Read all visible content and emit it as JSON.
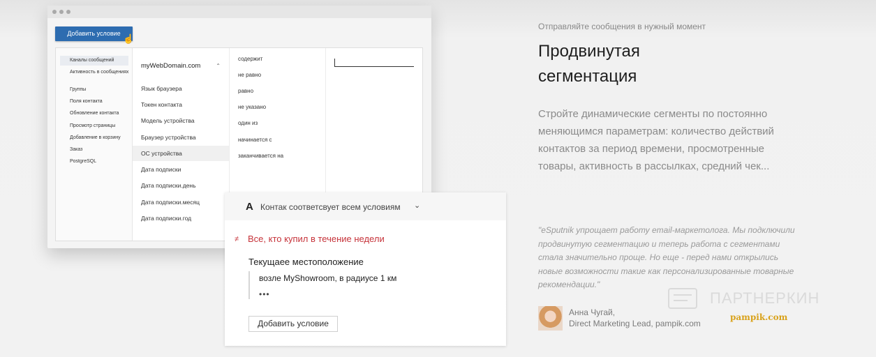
{
  "mockup": {
    "add_condition_button": "Добавить условие",
    "channels": [
      {
        "label": "Каналы сообщений",
        "active": true
      },
      {
        "label": "Активность в сообщениях"
      },
      {
        "label": "Группы"
      },
      {
        "label": "Поля контакта"
      },
      {
        "label": "Обновление контакта"
      },
      {
        "label": "Просмотр страницы"
      },
      {
        "label": "Добавление в корзину"
      },
      {
        "label": "Заказ"
      },
      {
        "label": "PostgreSQL"
      }
    ],
    "domain_header": "myWebDomain.com",
    "fields": [
      "Язык браузера",
      "Токен контакта",
      "Модель устройства",
      "Браузер устройства",
      "ОС устройства",
      "Дата подписки",
      "Дата подписки.день",
      "Дата подписки.месяц",
      "Дата подписки.год"
    ],
    "operators": [
      "содержит",
      "не равно",
      "равно",
      "не указано",
      "один из",
      "начинается с",
      "заканчивается на"
    ]
  },
  "condition_card": {
    "logic_letter": "A",
    "match_label": "Контак соответсвует всем условиям",
    "neq_symbol": "≠",
    "red_condition": "Все, кто купил в течение недели",
    "location_title": "Текущаее местоположение",
    "location_value": "возле MyShowroom, в радиусе 1 км",
    "more": "•••",
    "add_condition_button": "Добавить условие"
  },
  "feature": {
    "kicker": "Отправляйте сообщения в нужный момент",
    "headline_line1": "Продвинутая",
    "headline_line2": "сегментация",
    "description": "Стройте динамические сегменты по постоянно меняющимся параметрам: количество действий контактов за период времени, просмотренные товары, активность в рассылках, средний чек...",
    "quote": "\"eSputnik упрощает работу email-маркетолога. Мы подключили продвинутую сегментацию и теперь работа с сегментами стала значительно проще. Но еще - перед нами открылись новые возможности такие как персонализированные товарные рекомендации.\"",
    "author_name": "Анна Чугай,",
    "author_role": "Direct Marketing Lead, pampik.com",
    "brand_logo_text": "pampik.com"
  },
  "watermark": {
    "text": "ПАРТНЕРКИН"
  }
}
